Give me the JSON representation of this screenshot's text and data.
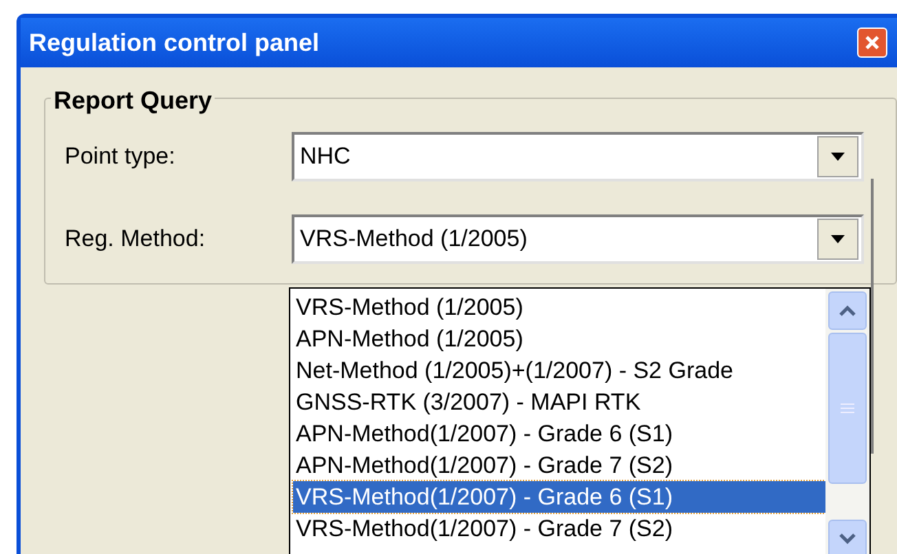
{
  "window": {
    "title": "Regulation control panel"
  },
  "group": {
    "title": "Report Query",
    "fields": [
      {
        "label": "Point type:",
        "value": "NHC"
      },
      {
        "label": "Reg. Method:",
        "value": "VRS-Method (1/2005)"
      }
    ]
  },
  "dropdown": {
    "options": [
      {
        "label": "VRS-Method (1/2005)",
        "selected": false
      },
      {
        "label": "APN-Method (1/2005)",
        "selected": false
      },
      {
        "label": "Net-Method (1/2005)+(1/2007) - S2 Grade",
        "selected": false
      },
      {
        "label": "GNSS-RTK (3/2007) - MAPI RTK",
        "selected": false
      },
      {
        "label": "APN-Method(1/2007) - Grade 6 (S1)",
        "selected": false
      },
      {
        "label": "APN-Method(1/2007) - Grade 7 (S2)",
        "selected": false
      },
      {
        "label": "VRS-Method(1/2007) - Grade 6 (S1)",
        "selected": true
      },
      {
        "label": "VRS-Method(1/2007) - Grade 7 (S2)",
        "selected": false
      }
    ]
  }
}
